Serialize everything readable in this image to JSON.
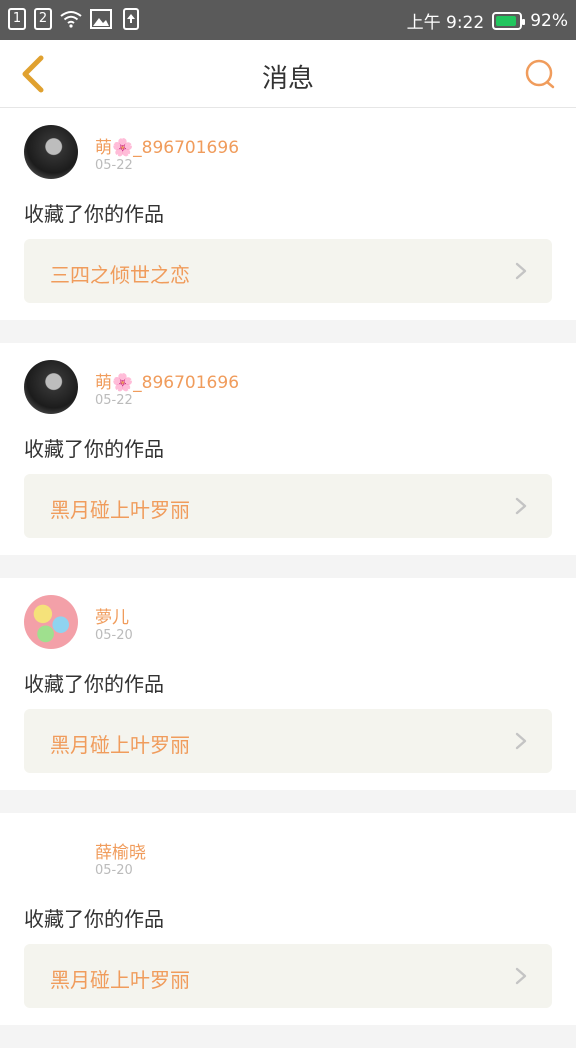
{
  "status_bar": {
    "sim1": "1",
    "sim2": "2",
    "time": "上午 9:22",
    "battery": "92%",
    "battery_level": 0.92,
    "battery_color": "#22c55e"
  },
  "header": {
    "title": "消息",
    "accent": "#f09c5c"
  },
  "notifications": [
    {
      "user": "萌🌸_896701696",
      "date": "05-22",
      "action": "收藏了你的作品",
      "work": "三四之倾世之恋",
      "avatar": "dark"
    },
    {
      "user": "萌🌸_896701696",
      "date": "05-22",
      "action": "收藏了你的作品",
      "work": "黑月碰上叶罗丽",
      "avatar": "dark"
    },
    {
      "user": "夢儿",
      "date": "05-20",
      "action": "收藏了你的作品",
      "work": "黑月碰上叶罗丽",
      "avatar": "color"
    },
    {
      "user": "薛榆晓",
      "date": "05-20",
      "action": "收藏了你的作品",
      "work": "黑月碰上叶罗丽",
      "avatar": "none"
    }
  ]
}
